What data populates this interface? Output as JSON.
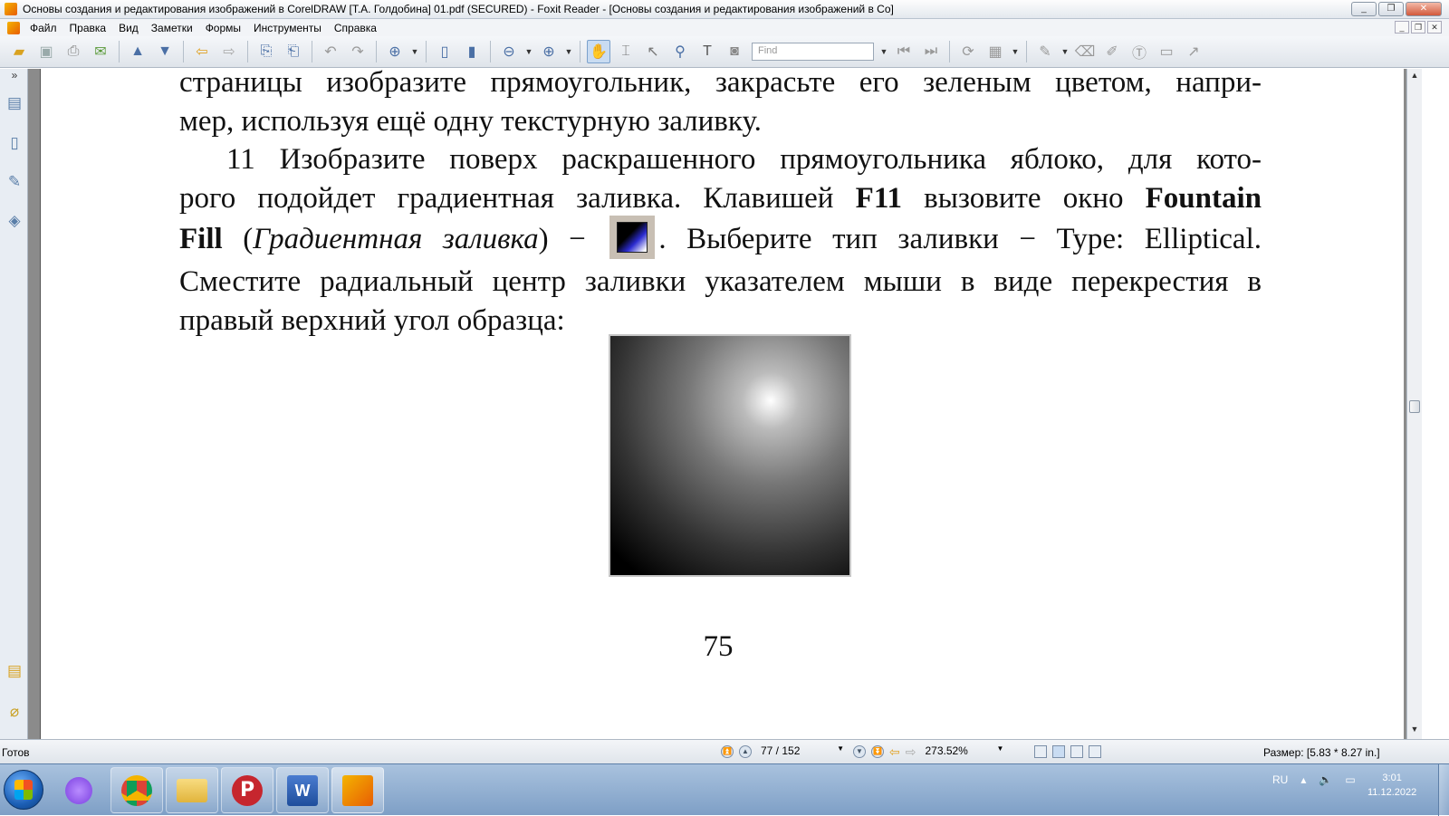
{
  "window": {
    "title": "Основы создания и редактирования изображений в CorelDRAW [Т.А. Голдобина] 01.pdf (SECURED) - Foxit Reader - [Основы создания и редактирования изображений в Со]",
    "minimize": "_",
    "restore": "❐",
    "close": "✕"
  },
  "menu": {
    "items": [
      "Файл",
      "Правка",
      "Вид",
      "Заметки",
      "Формы",
      "Инструменты",
      "Справка"
    ]
  },
  "toolbar": {
    "find_placeholder": "Find"
  },
  "document": {
    "para1": "страницы изобразите прямоугольник, закрасьте его зеленым цветом, например, используя ещё одну текстурную заливку.",
    "para1_line1": "страницы изобразите прямоугольник, закрасьте его зеленым цветом, напри-",
    "para1_line2": "мер, используя ещё одну текстурную заливку.",
    "p2_a": "11 Изобразите поверх раскрашенного прямоугольника яблоко, для кото-",
    "p2_b1": "рого подойдет градиентная заливка. Клавишей ",
    "p2_b_bold1": "F11",
    "p2_b2": " вызовите окно ",
    "p2_b_bold2": "Fountain",
    "p2_c_bold": "Fill",
    "p2_c1": " (",
    "p2_c_ital": "Градиентная заливка",
    "p2_c2": ") − ",
    "p2_c3": ". Выберите тип заливки − Type: Elliptical.",
    "p2_d": "Сместите радиальный центр заливки указателем мыши в виде перекрестия в",
    "p2_e": "правый верхний угол образца:",
    "page_number": "75"
  },
  "status": {
    "ready": "Готов",
    "page_display": "77 / 152",
    "zoom": "273.52%",
    "size": "Размер: [5.83 * 8.27 in.]"
  },
  "taskbar": {
    "lang": "RU",
    "time": "3:01",
    "date": "11.12.2022"
  }
}
